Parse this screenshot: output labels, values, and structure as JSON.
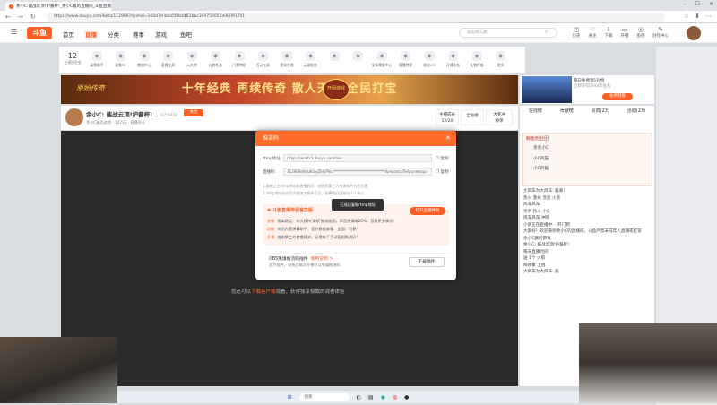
{
  "browser": {
    "tab_title": "余小C:酱战云顶!护酱杯!_余小C酱的直播间_斗鱼直播",
    "url": "https://www.douyu.com/beta/112906?dyshid=160d7d-bbd5f8b4461bbc384756051e00091701",
    "window_controls": [
      "–",
      "☐",
      "✕"
    ],
    "nav": [
      "←",
      "→",
      "↻"
    ],
    "toolbar_icons": [
      "☆",
      "⬇",
      "⋯"
    ]
  },
  "site": {
    "logo": "斗鱼",
    "nav": [
      "首页",
      "直播",
      "分类",
      "赛事",
      "游戏",
      "鱼吧"
    ],
    "search_placeholder": "宿舍蝴三姨",
    "header_icons": [
      "历史",
      "关注",
      "下载",
      "开播",
      "鱼吧",
      "创作中心"
    ]
  },
  "level": {
    "value": "12",
    "label": "主播经验值"
  },
  "categories": [
    "鲨鱼助手",
    "鲨鱼PK",
    "数据中心",
    "直播工具",
    "AI大师",
    "礼物任务",
    "门票特权",
    "互动工具",
    "竞技任务",
    "云端任务",
    "",
    "",
    "全场景客中心",
    "直播特权",
    "粉丝VIP",
    "开播任务",
    "礼物任务",
    "更多"
  ],
  "banner": {
    "logo": "原始传奇",
    "text": "十年经典 再续传奇 散人天堂 全民打宝",
    "badge": "开服游戏"
  },
  "ad": {
    "text": "每日免费领1礼物",
    "sub": "立即获得10000鱼丸",
    "button": "免费领取"
  },
  "anchor": {
    "title": "余小C: 酱战云顶!护酱杯!",
    "follow": "关注",
    "room": "3155932",
    "meta": "余小C酱的游戏  ·  14735  ·  直播时长"
  },
  "anchor_buttons": [
    {
      "l1": "主播成长",
      "l2": "12/20"
    },
    {
      "l1": "",
      "l2": "全站榜"
    },
    {
      "l1": "大奖冲",
      "l2": "榜单"
    }
  ],
  "video_text": {
    "pre": "您还可以",
    "link": "下载客户端",
    "post": "观看，获得独享极致的观看体验"
  },
  "chat": {
    "tabs": [
      "在线榜",
      "贡献榜",
      "贵宾(23)",
      "活动(23)"
    ],
    "fan_title": "鲸鱼粉丝团",
    "fans": [
      "亲亲小C",
      "小C的猫",
      "小C的酱"
    ],
    "lines": [
      "大风车为大风车: 酱来!",
      "热火 激光 流星 火箭",
      "风车风车",
      "亲亲 热火 小C",
      "风车风车 冲呀",
      "小窝正在直播中... 开门啊",
      "大家好！欢迎来到余小C的直播间，斗鱼严禁未成年人直播或打赏",
      "余小C酱的游戏",
      "余小C: 酱战云顶!护酱杯!",
      "每天直播时间",
      "送 1个 火箭",
      "网易聚 上线",
      "大风车为大风车: 酱"
    ]
  },
  "modal": {
    "title": "推流码",
    "close": "✕",
    "rtmp_label": "rtmp地址:",
    "rtmp_value": "rtmp://sendtc1.douyu.com/live",
    "key_label": "直播码:",
    "key_value": "112906eXUuKiayZIdyPN=*****************************&record=flv&rcneecup",
    "copy": "复制",
    "notes": [
      "1.复制上方rtmp地址和直播码后，粘贴到第三方推流软件对应位置",
      "2.rtmp地址仅在官方推流工具中可见，如需找回请前往个人中心"
    ],
    "toast": "已成功复制rtmp地址",
    "promo_title": "斗鱼直播伴侣官方版",
    "promo_button": "打开直播伴侣",
    "promo_lines": [
      {
        "tag": "流畅",
        "text": "框架稳定、永久保持'满帧'推流画面，声音更清晰20%，音质更多情况!"
      },
      {
        "tag": "功能",
        "text": "伴侣内置弹幕助手、官方数据查看、全面、可靠!"
      },
      {
        "tag": "开播",
        "text": "借助第三方转播模式，无需每下手动复制推流码!"
      }
    ],
    "obs_title": "OBS免填推流码插件",
    "obs_link": "使用说明 >",
    "obs_desc": "官方插件，安装后每次开播可以免填推流码",
    "obs_button": "下载插件"
  },
  "taskbar": {
    "search": "搜索",
    "icons": [
      "⊞",
      "◐",
      "▤",
      "◉",
      "◍",
      "●"
    ]
  }
}
